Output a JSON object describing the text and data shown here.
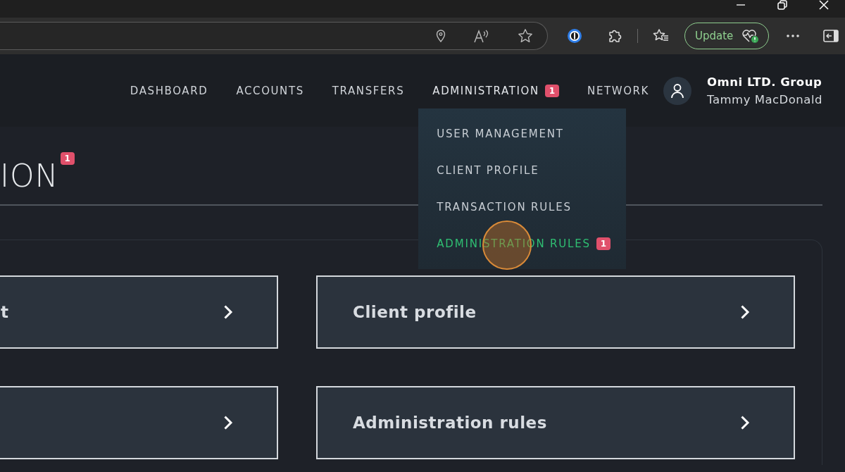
{
  "browser": {
    "update_button": {
      "label": "Update"
    }
  },
  "nav": {
    "items": [
      {
        "label": "DASHBOARD",
        "expanded": false
      },
      {
        "label": "ACCOUNTS",
        "expanded": false
      },
      {
        "label": "TRANSFERS",
        "expanded": false
      },
      {
        "label": "ADMINISTRATION",
        "badge": "1",
        "expanded": true
      },
      {
        "label": "NETWORK",
        "expanded": false
      }
    ],
    "user": {
      "company": "Omni LTD. Group",
      "name": "Tammy MacDonald"
    }
  },
  "dropdown": {
    "items": [
      {
        "label": "USER MANAGEMENT",
        "selected": false
      },
      {
        "label": "CLIENT PROFILE",
        "selected": false
      },
      {
        "label": "TRANSACTION RULES",
        "selected": false
      },
      {
        "label": "ADMINISTRATION RULES",
        "badge": "1",
        "selected": true
      }
    ]
  },
  "page": {
    "title": "ION",
    "badge": "1",
    "cards": [
      {
        "kind": "link",
        "title": "t"
      },
      {
        "kind": "link",
        "title": "Client profile"
      },
      {
        "kind": "link"
      },
      {
        "kind": "link",
        "title": "Administration rules"
      }
    ]
  }
}
